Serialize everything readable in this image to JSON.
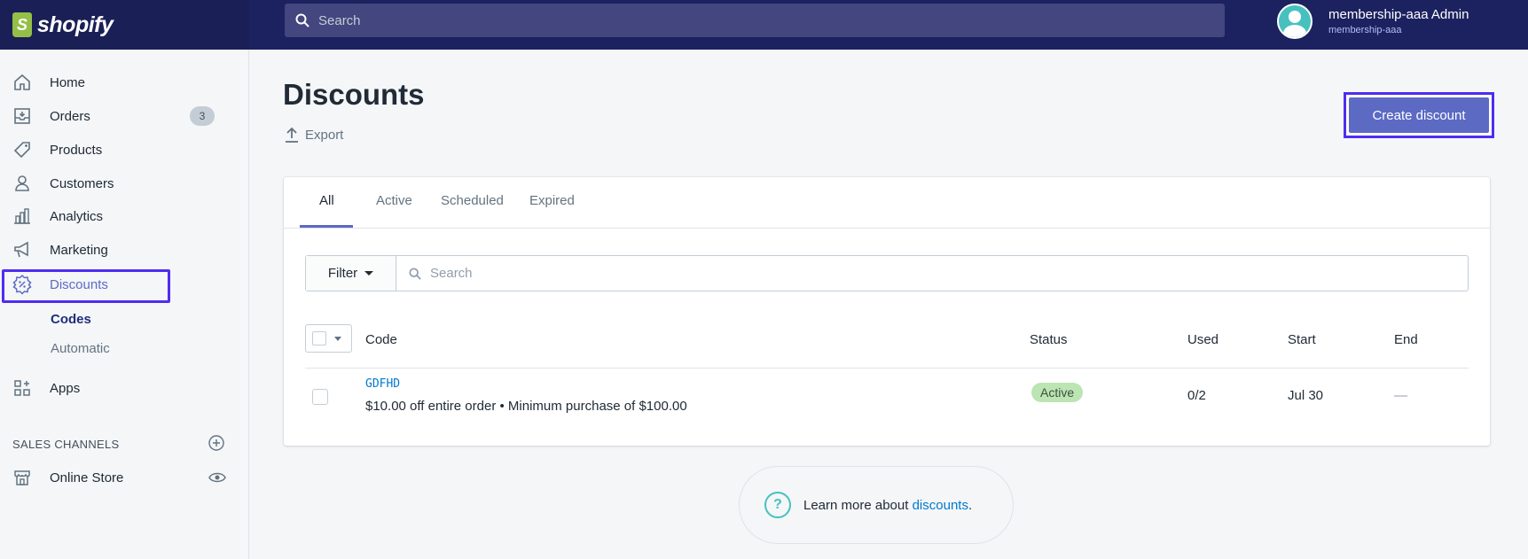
{
  "brand": {
    "name": "shopify",
    "bag_letter": "S"
  },
  "topbar": {
    "search_placeholder": "Search",
    "user_name": "membership-aaa Admin",
    "shop_name": "membership-aaa"
  },
  "sidebar": {
    "items": [
      {
        "label": "Home",
        "icon": "home-icon"
      },
      {
        "label": "Orders",
        "icon": "orders-icon",
        "badge": "3"
      },
      {
        "label": "Products",
        "icon": "tag-icon"
      },
      {
        "label": "Customers",
        "icon": "person-icon"
      },
      {
        "label": "Analytics",
        "icon": "bar-chart-icon"
      },
      {
        "label": "Marketing",
        "icon": "megaphone-icon"
      },
      {
        "label": "Discounts",
        "icon": "discount-icon",
        "selected": true
      },
      {
        "label": "Apps",
        "icon": "apps-icon"
      }
    ],
    "discount_sub": {
      "codes": "Codes",
      "automatic": "Automatic"
    },
    "sales_channels_heading": "SALES CHANNELS",
    "online_store": "Online Store"
  },
  "page": {
    "title": "Discounts",
    "export_label": "Export",
    "create_label": "Create discount"
  },
  "tabs": [
    "All",
    "Active",
    "Scheduled",
    "Expired"
  ],
  "filter": {
    "button_label": "Filter",
    "search_placeholder": "Search"
  },
  "table": {
    "headers": {
      "code": "Code",
      "status": "Status",
      "used": "Used",
      "start": "Start",
      "end": "End"
    },
    "rows": [
      {
        "code": "GDFHD",
        "description": "$10.00 off entire order • Minimum purchase of $100.00",
        "status": "Active",
        "used": "0/2",
        "start": "Jul 30",
        "end": "—"
      }
    ]
  },
  "footer_help": {
    "prefix": "Learn more about ",
    "link": "discounts",
    "suffix": "."
  },
  "colors": {
    "topbar": "#1c2260",
    "primary": "#5c6ac4",
    "highlight": "#4f2cf0",
    "link": "#007ace",
    "active_badge": "#bbe5b3",
    "brand_green": "#95bf47"
  }
}
